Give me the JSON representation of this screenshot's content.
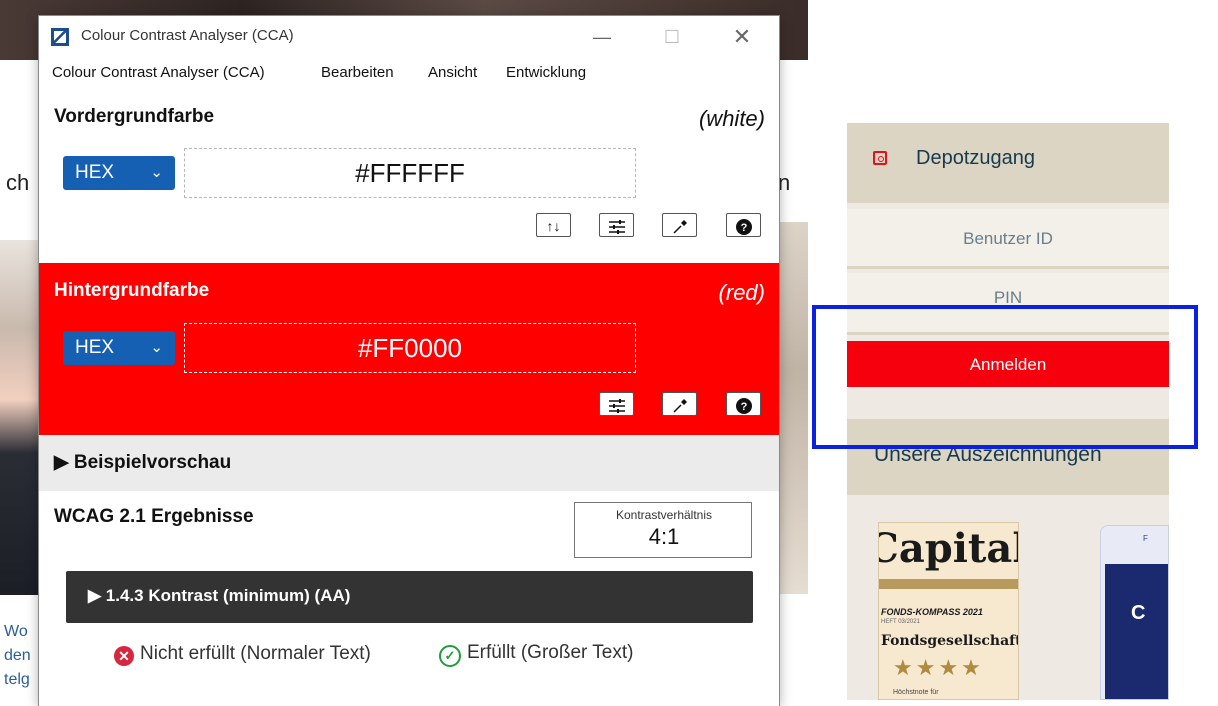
{
  "background_page": {
    "left_heading_fragment": "ch",
    "mid_heading_fragment": "n",
    "news_fragments": [
      "Wo",
      "den",
      "telg"
    ],
    "login": {
      "title": "Depotzugang",
      "user_placeholder": "Benutzer ID",
      "pin_placeholder": "PIN",
      "submit_label": "Anmelden"
    },
    "awards": {
      "title": "Unsere Auszeichnungen",
      "capital": {
        "brand": "Capital",
        "kompass": "FONDS-KOMPASS 2021",
        "sub": "HEFT 03/2021",
        "label": "Fondsgesellschaft",
        "stars": "★★★★",
        "note": "Höchstnote für"
      },
      "second": {
        "letter": "C",
        "fragment": "F"
      }
    }
  },
  "window": {
    "title": "Colour Contrast Analyser (CCA)",
    "controls": {
      "minimize": "—",
      "maximize": "☐",
      "close": "✕"
    },
    "menu": [
      "Colour Contrast Analyser (CCA)",
      "Bearbeiten",
      "Ansicht",
      "Entwicklung"
    ],
    "foreground": {
      "title": "Vordergrundfarbe",
      "color_name": "(white)",
      "format": "HEX",
      "value": "#FFFFFF"
    },
    "background": {
      "title": "Hintergrundfarbe",
      "color_name": "(red)",
      "format": "HEX",
      "value": "#FF0000"
    },
    "preview": {
      "label": "▶ Beispielvorschau"
    },
    "results": {
      "title": "WCAG 2.1 Ergebnisse",
      "ratio_label": "Kontrastverhältnis",
      "ratio_value": "4:1",
      "criterion": "▶ 1.4.3 Kontrast (minimum) (AA)",
      "fail_text": "Nicht erfüllt (Normaler Text)",
      "pass_text": "Erfüllt (Großer Text)"
    }
  },
  "colors": {
    "accent_blue": "#1660b4",
    "red": "#ff0000",
    "login_button": "#f7000d",
    "highlight": "#0a22e0",
    "panel_bg": "#eeeae3",
    "panel_head": "#dcd5c3"
  }
}
